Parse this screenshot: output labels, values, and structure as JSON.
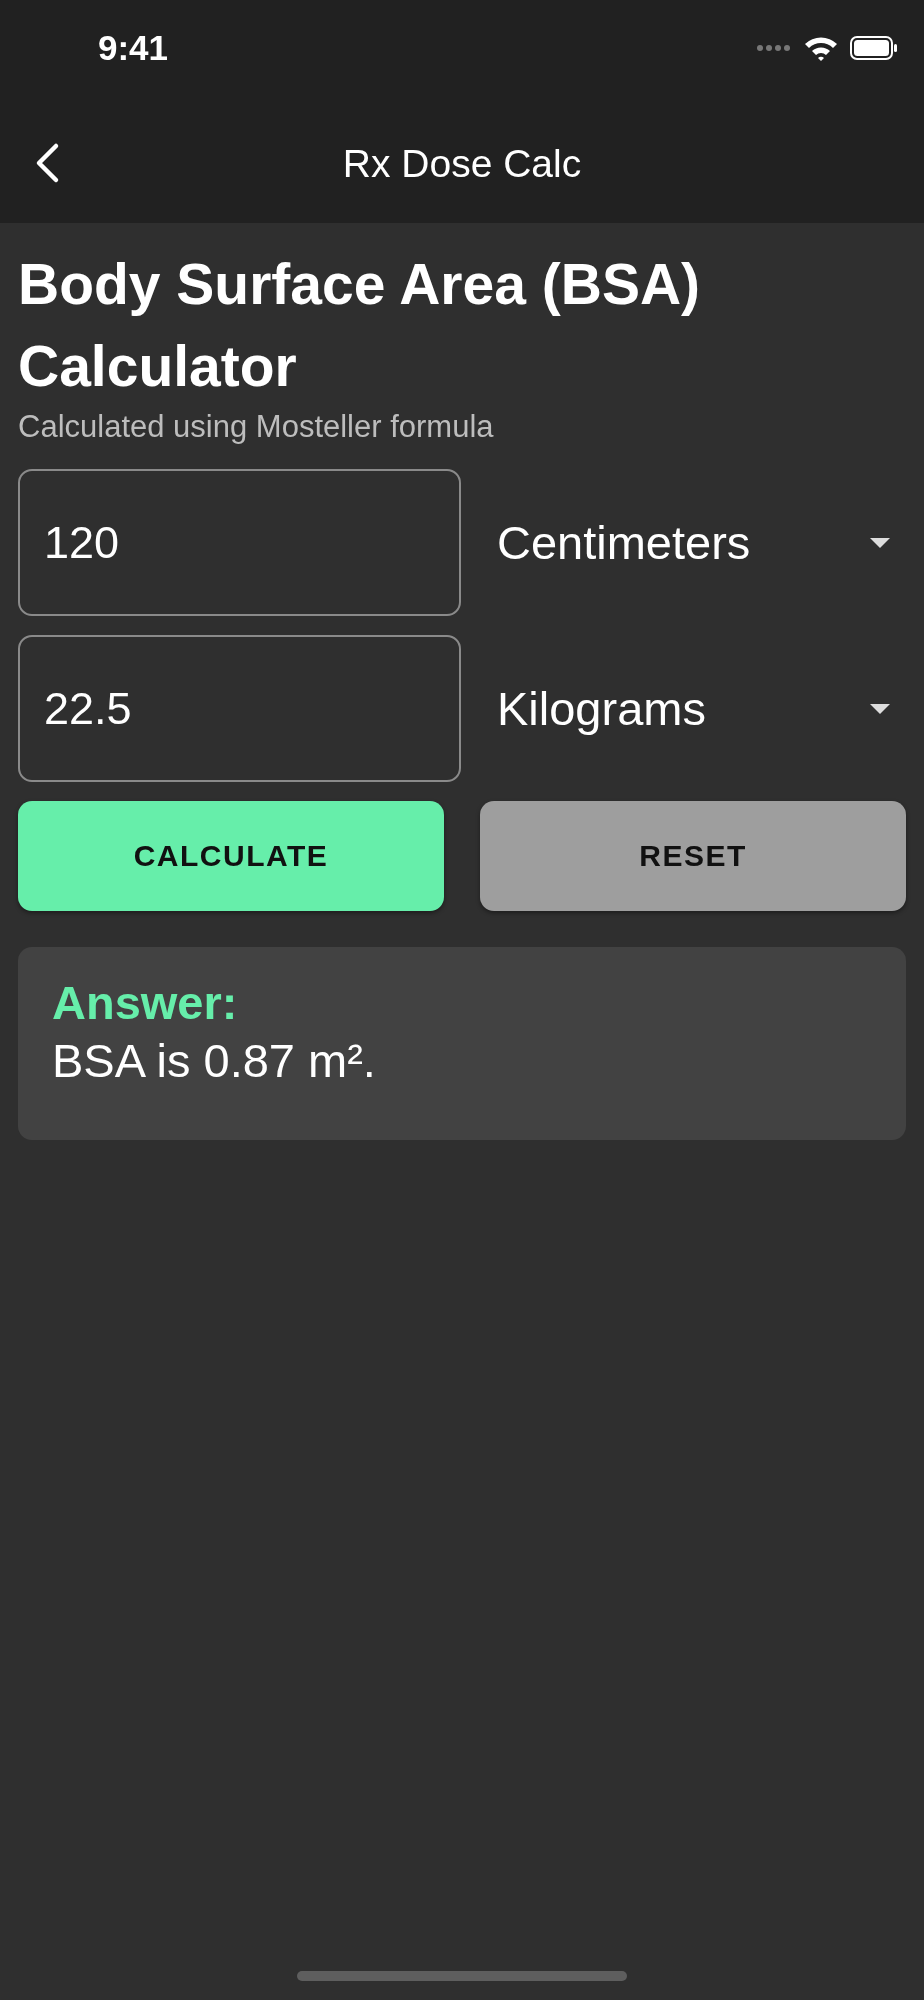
{
  "status_bar": {
    "time": "9:41"
  },
  "app_bar": {
    "title": "Rx Dose Calc"
  },
  "heading": "Body Surface Area (BSA) Calculator",
  "subtitle": "Calculated using Mosteller formula",
  "inputs": [
    {
      "value": "120",
      "unit": "Centimeters"
    },
    {
      "value": "22.5",
      "unit": "Kilograms"
    }
  ],
  "buttons": [
    {
      "label": "CALCULATE",
      "kind": "primary"
    },
    {
      "label": "RESET",
      "kind": "secondary"
    }
  ],
  "answer": {
    "label": "Answer:",
    "text": "BSA is 0.87 m²."
  }
}
